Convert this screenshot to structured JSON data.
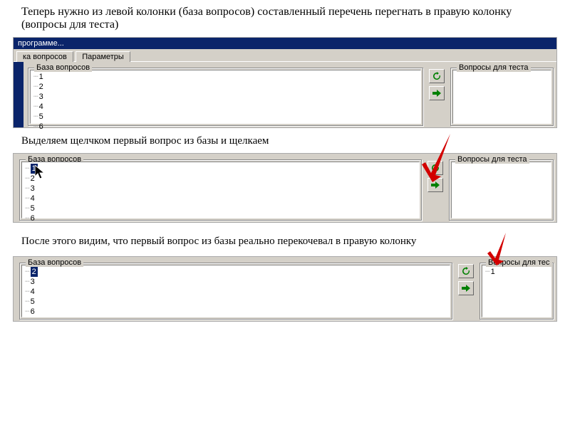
{
  "caption1": "Теперь нужно из левой колонки (база вопросов) составленный перечень перегнать в правую колонку (вопросы для теста)",
  "caption2": "Выделяем щелчком первый вопрос из базы и щелкаем",
  "caption3": "После этого видим, что первый вопрос из базы реально перекочевал в правую колонку",
  "shot1": {
    "titlebar": "программе...",
    "tab_left": "ка вопросов",
    "tab_right": "Параметры",
    "left_group": "База вопросов",
    "right_group": "Вопросы для теста",
    "left_items": [
      "1",
      "2",
      "3",
      "4",
      "5",
      "6"
    ]
  },
  "shot2": {
    "left_group": "База вопросов",
    "right_group": "Вопросы для теста",
    "left_items": [
      "1",
      "2",
      "3",
      "4",
      "5",
      "6"
    ],
    "selected": "1"
  },
  "shot3": {
    "left_group": "База вопросов",
    "right_group": "Вопросы для тес",
    "left_items": [
      "2",
      "3",
      "4",
      "5",
      "6"
    ],
    "right_items": [
      "1"
    ],
    "selected": "2"
  }
}
